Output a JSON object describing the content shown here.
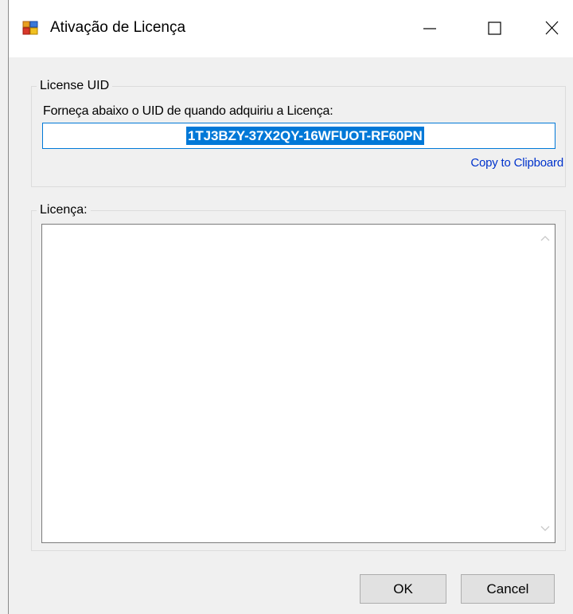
{
  "window": {
    "title": "Ativação de Licença",
    "icon": "app-window-icon",
    "controls": {
      "minimize": "minimize-icon",
      "maximize": "maximize-icon",
      "close": "close-icon"
    }
  },
  "uid_group": {
    "legend": "License UID",
    "prompt": "Forneça abaixo o UID de quando adquiriu a Licença:",
    "uid_value": "1TJ3BZY-37X2QY-16WFUOT-RF60PN",
    "copy_link": "Copy to Clipboard"
  },
  "license_group": {
    "legend": "Licença:",
    "license_value": ""
  },
  "buttons": {
    "ok": "OK",
    "cancel": "Cancel"
  },
  "colors": {
    "selection": "#0078d7",
    "link": "#0033cc",
    "background": "#f0f0f0"
  }
}
